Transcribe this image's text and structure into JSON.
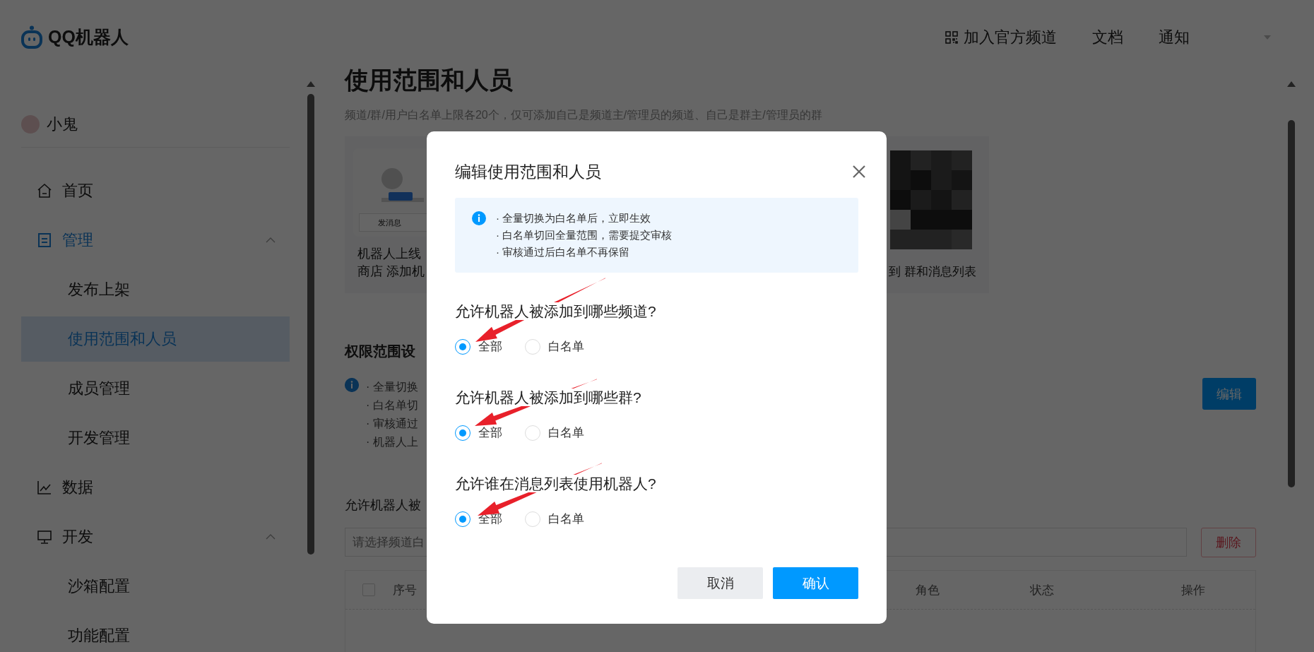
{
  "header": {
    "logo_text": "QQ机器人",
    "links": [
      {
        "label": "加入官方频道",
        "kind": "grid"
      },
      {
        "label": "文档",
        "kind": "text"
      },
      {
        "label": "通知",
        "kind": "text"
      }
    ]
  },
  "user": {
    "name": "小鬼"
  },
  "sidebar": {
    "items": [
      {
        "label": "首页",
        "selected": false
      },
      {
        "label": "管理",
        "expanded": true,
        "selected": false,
        "children": [
          {
            "label": "发布上架",
            "selected": false
          },
          {
            "label": "使用范围和人员",
            "selected": true
          },
          {
            "label": "成员管理",
            "selected": false
          },
          {
            "label": "开发管理",
            "selected": false
          }
        ]
      },
      {
        "label": "数据",
        "selected": false
      },
      {
        "label": "开发",
        "expanded": true,
        "selected": false,
        "children": [
          {
            "label": "沙箱配置",
            "selected": false
          },
          {
            "label": "功能配置",
            "selected": false
          }
        ]
      }
    ]
  },
  "page": {
    "title": "使用范围和人员",
    "subtitle": "频道/群/用户白名单上限各20个，仅可添加自己是频道主/管理员的频道、自己是群主/管理员的群",
    "cards": [
      {
        "kind": "illustration",
        "button_text": "发消息",
        "caption_lines": [
          "机器人上线",
          "商店 添加机"
        ]
      },
      {
        "kind": "qr",
        "caption_lines": [
          "到 群和消息列表"
        ]
      }
    ],
    "permissions": {
      "title": "权限范围设",
      "notes": [
        "· 全量切换",
        "· 白名单切",
        "· 审核通过",
        "· 机器人上"
      ],
      "edit_button": "编辑"
    },
    "whitelist": {
      "label": "允许机器人被",
      "placeholder": "请选择频道白",
      "delete_button": "删除",
      "select_all": {
        "checked": false
      },
      "columns": [
        "序号",
        "角色",
        "状态",
        "操作"
      ]
    }
  },
  "dialog": {
    "title": "编辑使用范围和人员",
    "notes": [
      "· 全量切换为白名单后，立即生效",
      "· 白名单切回全量范围，需要提交审核",
      "· 审核通过后白名单不再保留"
    ],
    "questions": [
      {
        "label": "允许机器人被添加到哪些频道?",
        "options": [
          {
            "label": "全部",
            "selected": true
          },
          {
            "label": "白名单",
            "selected": false
          }
        ]
      },
      {
        "label": "允许机器人被添加到哪些群?",
        "options": [
          {
            "label": "全部",
            "selected": true
          },
          {
            "label": "白名单",
            "selected": false
          }
        ]
      },
      {
        "label": "允许谁在消息列表使用机器人?",
        "options": [
          {
            "label": "全部",
            "selected": true
          },
          {
            "label": "白名单",
            "selected": false
          }
        ]
      }
    ],
    "buttons": [
      {
        "label": "取消",
        "kind": "secondary"
      },
      {
        "label": "确认",
        "kind": "primary"
      }
    ]
  }
}
